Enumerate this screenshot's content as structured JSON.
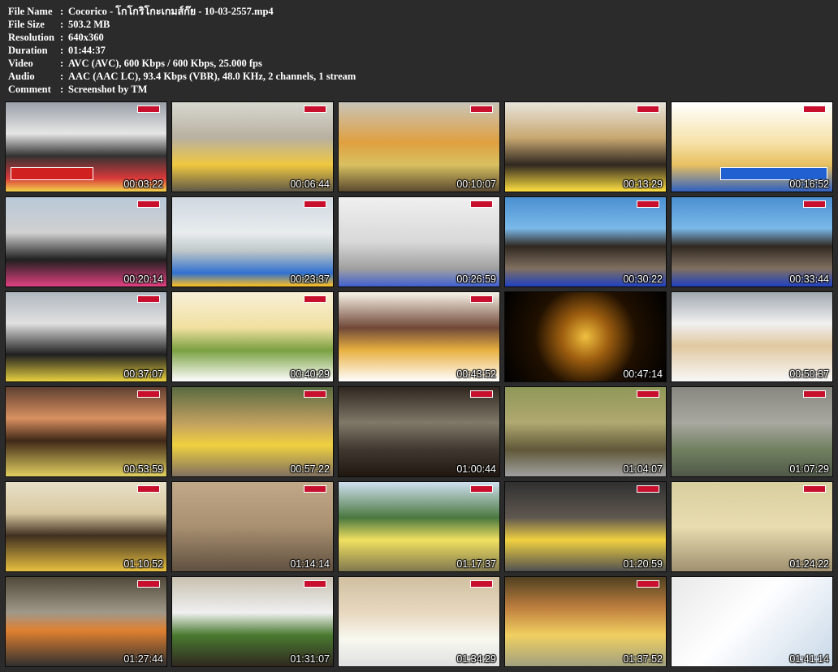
{
  "info": [
    {
      "key": "File Name",
      "value": "Cocorico - โกโกริโกะเกมส์ก๊ย - 10-03-2557.mp4"
    },
    {
      "key": "File Size",
      "value": "503.2 MB"
    },
    {
      "key": "Resolution",
      "value": "640x360"
    },
    {
      "key": "Duration",
      "value": "01:44:37"
    },
    {
      "key": "Video",
      "value": "AVC (AVC), 600 Kbps / 600 Kbps, 25.000 fps"
    },
    {
      "key": "Audio",
      "value": "AAC (AAC LC), 93.4 Kbps (VBR), 48.0 KHz, 2 channels, 1 stream"
    },
    {
      "key": "Comment",
      "value": "Screenshot by TM"
    }
  ],
  "separator": ":",
  "thumbnails": [
    {
      "time": "00:03:22"
    },
    {
      "time": "00:06:44"
    },
    {
      "time": "00:10:07"
    },
    {
      "time": "00:13:29"
    },
    {
      "time": "00:16:52"
    },
    {
      "time": "00:20:14"
    },
    {
      "time": "00:23:37"
    },
    {
      "time": "00:26:59"
    },
    {
      "time": "00:30:22"
    },
    {
      "time": "00:33:44"
    },
    {
      "time": "00:37:07"
    },
    {
      "time": "00:40:29"
    },
    {
      "time": "00:43:52"
    },
    {
      "time": "00:47:14"
    },
    {
      "time": "00:50:37"
    },
    {
      "time": "00:53:59"
    },
    {
      "time": "00:57:22"
    },
    {
      "time": "01:00:44"
    },
    {
      "time": "01:04:07"
    },
    {
      "time": "01:07:29"
    },
    {
      "time": "01:10:52"
    },
    {
      "time": "01:14:14"
    },
    {
      "time": "01:17:37"
    },
    {
      "time": "01:20:59"
    },
    {
      "time": "01:24:22"
    },
    {
      "time": "01:27:44"
    },
    {
      "time": "01:31:07"
    },
    {
      "time": "01:34:29"
    },
    {
      "time": "01:37:52"
    },
    {
      "time": "01:41:14"
    }
  ],
  "colors": {
    "background": "#2b2b2b",
    "text": "#ffffff",
    "tv_logo": "#c8102e"
  }
}
